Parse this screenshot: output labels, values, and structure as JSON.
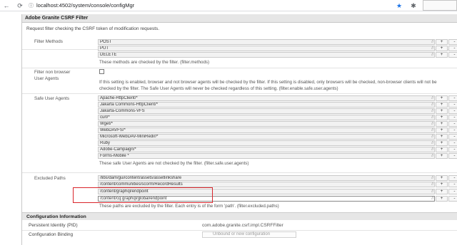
{
  "browser": {
    "url": "localhost:4502/system/console/configMgr",
    "back_glyph": "←",
    "reload_glyph": "⟳",
    "lock_glyph": "ⓘ",
    "star_glyph": "★",
    "puzzle_glyph": "✱"
  },
  "dialog": {
    "title": "Adobe Granite CSRF Filter",
    "description": "Request filter checking the CSRF token of modification requests."
  },
  "filter_methods": {
    "label": "Filter Methods",
    "values": [
      "POST",
      "PUT",
      "DELETE"
    ],
    "help": "These methods are checked by the filter. (filter.methods)"
  },
  "non_browser": {
    "label_line1": "Filter non browser",
    "label_line2": "User Agents",
    "checked": false,
    "help_line1": "If this setting is enabled, browser and not browser agents will be checked by the filter. If this setting is disabled, only browsers will be checked, non-browser clients will not be",
    "help_line2": "checked by the filter. The Safe User Agents will never be checked regardless of this setting. (filter.enable.safe.user.agents)"
  },
  "safe_user_agents": {
    "label": "Safe User Agents",
    "values": [
      "Apache-HttpClient/*",
      "Jakarta Commons-HttpClient/*",
      "Jakarta-Commons-VFS",
      "curl/*",
      "Wget/*",
      "WebDAVFS/*",
      "Microsoft-WebDAV-MiniRedir/*",
      "Ruby",
      "Adobe-Campaign/*",
      "Forms-Mobile *"
    ],
    "help": "These safe User Agents are not checked by the filter. (filter.safe.user.agents)"
  },
  "excluded_paths": {
    "label": "Excluded Paths",
    "values": [
      "/libs/dam/gui/content/assets/assetlinkshare",
      "/content/communities/scorm/RecordResults",
      "/content/graphql/endpoint",
      "/content/cq:graphql/global/endpoint"
    ],
    "help": "These paths are excluded by the filter. Each entry is of the form 'path'. (filter.excluded.paths)"
  },
  "buttons": {
    "add": "+",
    "remove": "-"
  },
  "configuration": {
    "header": "Configuration Information",
    "pid_label": "Persistent Identity (PID)",
    "pid_value": "com.adobe.granite.csrf.impl.CSRFFilter",
    "binding_label": "Configuration Binding",
    "binding_value": "Unbound or new configuration"
  }
}
